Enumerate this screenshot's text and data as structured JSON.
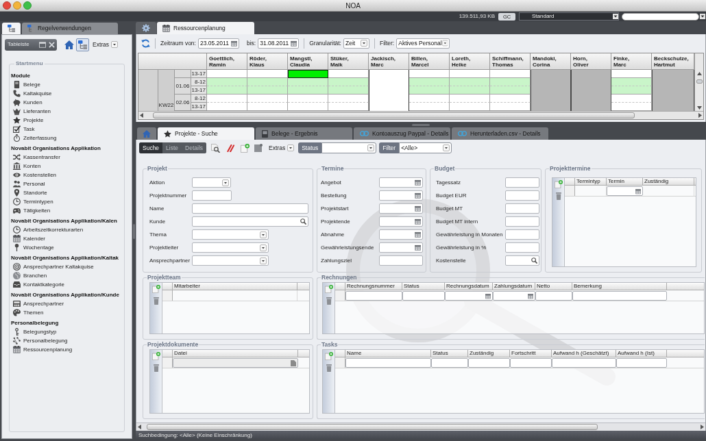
{
  "window": {
    "title": "NOA"
  },
  "top_bar": {
    "memory": "139.511,93 KB",
    "gc_button": "GC",
    "profile": "Standard"
  },
  "side_panel": {
    "tabs": [
      {
        "selected": true
      },
      {
        "label": "Regelverwendungen",
        "selected": false
      }
    ],
    "toolbar": {
      "tab_bar": "Tableiste",
      "tree_toggle": {
        "selected": true
      },
      "extras": "Extras"
    },
    "start_menu": {
      "title": "Startmenu",
      "sections": [
        {
          "heading": "Module",
          "items": [
            "Belege",
            "Kaltakquise",
            "Kunden",
            "Lieferanten",
            "Projekte",
            "Task",
            "Zeiterfassung"
          ]
        },
        {
          "heading": "Novabit Organisations Applikation",
          "items": [
            "Kassentransfer",
            "Konten",
            "Kostenstellen",
            "Personal",
            "Standorte",
            "Termintypen",
            "Tätigkeiten"
          ]
        },
        {
          "heading": "Novabit Organisations Applikation/Kalen",
          "items": [
            "Arbeitszeitkorrekturarten",
            "Kalender",
            "Wochentage"
          ]
        },
        {
          "heading": "Novabit Organisations Applikation/Kaltak",
          "items": [
            "Ansprechpartner Kaltakquise",
            "Branchen",
            "Kontaktkategorie"
          ]
        },
        {
          "heading": "Novabit Organisations Applikation/Kunde",
          "items": [
            "Ansprechpartner",
            "Themen"
          ]
        },
        {
          "heading": "Personalbelegung",
          "items": [
            "Belegungstyp",
            "Personalbelegung",
            "Ressourcenplanung"
          ]
        }
      ]
    }
  },
  "resource_planning": {
    "tabs": [
      {
        "selected": false
      },
      {
        "label": "Ressourcenplanung",
        "selected": true
      }
    ],
    "toolbar": {
      "from_label": "Zeitraum von:",
      "from": "23.05.2011",
      "to_label": "bis:",
      "to": "31.08.2011",
      "granularity_label": "Granularität:",
      "granularity": "Zeit",
      "filter_label": "Filter:",
      "filter": "Aktives Personal"
    },
    "grid": {
      "week": "KW22",
      "rows": [
        {
          "time": "13-17"
        },
        {
          "date": "01.06",
          "time": "8-12"
        },
        {
          "time": "13-17"
        },
        {
          "date": "02.06",
          "time": "8-12"
        },
        {
          "time": "13-17"
        }
      ],
      "columns": [
        {
          "name": "Goettlich, Ramin",
          "cells": [
            {
              "kind": "free"
            },
            {
              "kind": "holiday"
            },
            {
              "kind": "holiday"
            },
            {
              "kind": "free"
            },
            {
              "kind": "free"
            }
          ]
        },
        {
          "name": "Röder, Klaus",
          "cells": [
            {
              "kind": "free"
            },
            {
              "kind": "holiday"
            },
            {
              "kind": "holiday"
            },
            {
              "kind": "free"
            },
            {
              "kind": "free"
            }
          ]
        },
        {
          "name": "Mangstl, Claudia",
          "cells": [
            {
              "kind": "booked"
            },
            {
              "kind": "holiday"
            },
            {
              "kind": "holiday"
            },
            {
              "kind": "free"
            },
            {
              "kind": "free"
            }
          ]
        },
        {
          "name": "Stüker, Maik",
          "cells": [
            {
              "kind": "free"
            },
            {
              "kind": "holiday"
            },
            {
              "kind": "holiday"
            },
            {
              "kind": "free"
            },
            {
              "kind": "free"
            }
          ]
        },
        {
          "name": "Jackisch, Marc",
          "cells": [
            {
              "kind": "blocked"
            },
            {
              "kind": "blocked"
            },
            {
              "kind": "blocked"
            },
            {
              "kind": "blocked"
            },
            {
              "kind": "blocked"
            }
          ]
        },
        {
          "name": "Billen, Marcel",
          "cells": [
            {
              "kind": "free"
            },
            {
              "kind": "holiday"
            },
            {
              "kind": "holiday"
            },
            {
              "kind": "free"
            },
            {
              "kind": "free"
            }
          ]
        },
        {
          "name": "Loreth, Heike",
          "cells": [
            {
              "kind": "free"
            },
            {
              "kind": "holiday"
            },
            {
              "kind": "holiday"
            },
            {
              "kind": "free"
            },
            {
              "kind": "free"
            }
          ]
        },
        {
          "name": "Schiffmann, Thomas",
          "cells": [
            {
              "kind": "free"
            },
            {
              "kind": "holiday"
            },
            {
              "kind": "holiday"
            },
            {
              "kind": "free"
            },
            {
              "kind": "free"
            }
          ]
        },
        {
          "name": "Mandoki, Corina",
          "cells": [
            {
              "kind": "absent"
            },
            {
              "kind": "absent"
            },
            {
              "kind": "absent"
            },
            {
              "kind": "absent"
            },
            {
              "kind": "absent"
            }
          ]
        },
        {
          "name": "Horn, Oliver",
          "cells": [
            {
              "kind": "absent"
            },
            {
              "kind": "absent"
            },
            {
              "kind": "absent"
            },
            {
              "kind": "absent"
            },
            {
              "kind": "absent"
            }
          ]
        },
        {
          "name": "Finke, Marc",
          "cells": [
            {
              "kind": "free"
            },
            {
              "kind": "holiday"
            },
            {
              "kind": "holiday"
            },
            {
              "kind": "free"
            },
            {
              "kind": "free"
            }
          ]
        },
        {
          "name": "Beckschulze, Hartmut",
          "cells": [
            {
              "kind": "absent"
            },
            {
              "kind": "absent"
            },
            {
              "kind": "absent"
            },
            {
              "kind": "absent"
            },
            {
              "kind": "absent"
            }
          ]
        }
      ]
    }
  },
  "search_view": {
    "tabs": [
      {
        "selected": false
      },
      {
        "label": "Projekte - Suche",
        "selected": true
      },
      {
        "label": "Belege - Ergebnis",
        "selected": false
      },
      {
        "label": "Kontoauszug Paypal - Details",
        "selected": false
      },
      {
        "label": "Herunterladen.csv - Details",
        "selected": false
      }
    ],
    "modes": [
      {
        "label": "Suche",
        "selected": true,
        "disabled": false
      },
      {
        "label": "Liste",
        "selected": false,
        "disabled": true
      },
      {
        "label": "Details",
        "selected": false,
        "disabled": true
      }
    ],
    "extras": "Extras",
    "status": {
      "label": "Status"
    },
    "filter": {
      "label": "Filter",
      "value": "<Alle>"
    },
    "groups": [
      {
        "title": "Projekt",
        "fields": [
          {
            "label": "Aktion",
            "kind": "select"
          },
          {
            "label": "Projektnummer",
            "kind": "text"
          },
          {
            "label": "Name",
            "kind": "text"
          },
          {
            "label": "Kunde",
            "kind": "lookup"
          },
          {
            "label": "Thema",
            "kind": "select"
          },
          {
            "label": "Projektleiter",
            "kind": "select"
          },
          {
            "label": "Ansprechpartner",
            "kind": "select"
          }
        ]
      },
      {
        "title": "Termine",
        "fields": [
          {
            "label": "Angebot",
            "kind": "date"
          },
          {
            "label": "Bestellung",
            "kind": "date"
          },
          {
            "label": "Projektstart",
            "kind": "date"
          },
          {
            "label": "Projektende",
            "kind": "date"
          },
          {
            "label": "Abnahme",
            "kind": "date"
          },
          {
            "label": "Gewährleistungsende",
            "kind": "date"
          },
          {
            "label": "Zahlungsziel",
            "kind": "text"
          }
        ]
      },
      {
        "title": "Budget",
        "fields": [
          {
            "label": "Tagessatz",
            "kind": "text"
          },
          {
            "label": "Budget EUR",
            "kind": "text"
          },
          {
            "label": "Budget MT",
            "kind": "text"
          },
          {
            "label": "Budget MT intern",
            "kind": "text"
          },
          {
            "label": "Gewährleistung in Monaten",
            "kind": "text"
          },
          {
            "label": "Gewährleistung in %",
            "kind": "text"
          },
          {
            "label": "Kostenstelle",
            "kind": "lookup"
          }
        ]
      },
      {
        "title": "Projekttermine",
        "columns": [
          {
            "label": "Termintyp",
            "kind": "plain"
          },
          {
            "label": "Termin",
            "kind": "date"
          },
          {
            "label": "Zuständig",
            "kind": "plain"
          }
        ]
      },
      {
        "title": "Projektteam",
        "columns": [
          {
            "label": "Mitarbeiter",
            "kind": "plain"
          }
        ]
      },
      {
        "title": "Rechnungen",
        "columns": [
          {
            "label": "Rechnungsnummer",
            "kind": "text"
          },
          {
            "label": "Status",
            "kind": "text"
          },
          {
            "label": "Rechnungsdatum",
            "kind": "date"
          },
          {
            "label": "Zahlungsdatum",
            "kind": "date"
          },
          {
            "label": "Netto",
            "kind": "text"
          },
          {
            "label": "Bemerkung",
            "kind": "text"
          }
        ]
      },
      {
        "title": "Projektdokumente",
        "columns": [
          {
            "label": "Datei",
            "kind": "file"
          }
        ]
      },
      {
        "title": "Tasks",
        "columns": [
          {
            "label": "Name",
            "kind": "text"
          },
          {
            "label": "Status",
            "kind": "text"
          },
          {
            "label": "Zuständig",
            "kind": "text"
          },
          {
            "label": "Fortschritt",
            "kind": "text"
          },
          {
            "label": "Aufwand h (Geschätzt)",
            "kind": "text"
          },
          {
            "label": "Aufwand h (Ist)",
            "kind": "text"
          }
        ]
      }
    ]
  },
  "status_bar": "Suchbedingung: <Alle> (Keine Einschränkung)"
}
